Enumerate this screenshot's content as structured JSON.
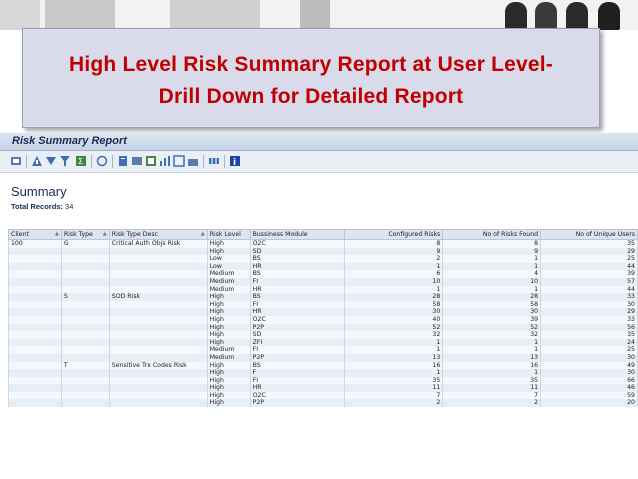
{
  "slide": {
    "title_line1": "High Level Risk Summary Report at User Level-",
    "title_line2": "Drill Down for Detailed Report"
  },
  "window": {
    "title": "Risk Summary Report"
  },
  "toolbar": {
    "icons": [
      "refresh-icon",
      "detail-icon",
      "sort-ascending-icon",
      "filter-icon",
      "sum-icon",
      "print-icon",
      "export-icon",
      "view-icon",
      "spreadsheet-icon",
      "graph-icon",
      "layout-icon",
      "info-icon"
    ]
  },
  "report": {
    "summary_label": "Summary",
    "total_label": "Total Records:",
    "total_value": "34"
  },
  "table": {
    "headers": [
      "Client",
      "Risk Type",
      "Risk Type Desc",
      "Risk Level",
      "Bussiness Module",
      "Configured Risks",
      "No of Risks Found",
      "No of Unique Users"
    ],
    "rows": [
      [
        "100",
        "G",
        "Critical Auth Objs Risk",
        "High",
        "O2C",
        "8",
        "8",
        "35"
      ],
      [
        "",
        "",
        "",
        "High",
        "SD",
        "9",
        "9",
        "29"
      ],
      [
        "",
        "",
        "",
        "Low",
        "BS",
        "2",
        "1",
        "25"
      ],
      [
        "",
        "",
        "",
        "Low",
        "HR",
        "1",
        "1",
        "44"
      ],
      [
        "",
        "",
        "",
        "Medium",
        "BS",
        "6",
        "4",
        "39"
      ],
      [
        "",
        "",
        "",
        "Medium",
        "FI",
        "10",
        "10",
        "57"
      ],
      [
        "",
        "",
        "",
        "Medium",
        "HR",
        "1",
        "1",
        "44"
      ],
      [
        "",
        "S",
        "SOD Risk",
        "High",
        "BS",
        "28",
        "28",
        "33"
      ],
      [
        "",
        "",
        "",
        "High",
        "FI",
        "58",
        "58",
        "30"
      ],
      [
        "",
        "",
        "",
        "High",
        "HR",
        "30",
        "30",
        "29"
      ],
      [
        "",
        "",
        "",
        "High",
        "O2C",
        "40",
        "39",
        "33"
      ],
      [
        "",
        "",
        "",
        "High",
        "P2P",
        "52",
        "52",
        "56"
      ],
      [
        "",
        "",
        "",
        "High",
        "SD",
        "32",
        "32",
        "35"
      ],
      [
        "",
        "",
        "",
        "High",
        "ZFI",
        "1",
        "1",
        "24"
      ],
      [
        "",
        "",
        "",
        "Medium",
        "FI",
        "1",
        "1",
        "25"
      ],
      [
        "",
        "",
        "",
        "Medium",
        "P2P",
        "13",
        "13",
        "30"
      ],
      [
        "",
        "T",
        "Sensitive Trx Codes Risk",
        "High",
        "BS",
        "16",
        "16",
        "49"
      ],
      [
        "",
        "",
        "",
        "High",
        "F",
        "1",
        "1",
        "30"
      ],
      [
        "",
        "",
        "",
        "High",
        "FI",
        "35",
        "35",
        "66"
      ],
      [
        "",
        "",
        "",
        "High",
        "HR",
        "11",
        "11",
        "46"
      ],
      [
        "",
        "",
        "",
        "High",
        "O2C",
        "7",
        "7",
        "59"
      ],
      [
        "",
        "",
        "",
        "High",
        "P2P",
        "2",
        "2",
        "20"
      ]
    ]
  }
}
